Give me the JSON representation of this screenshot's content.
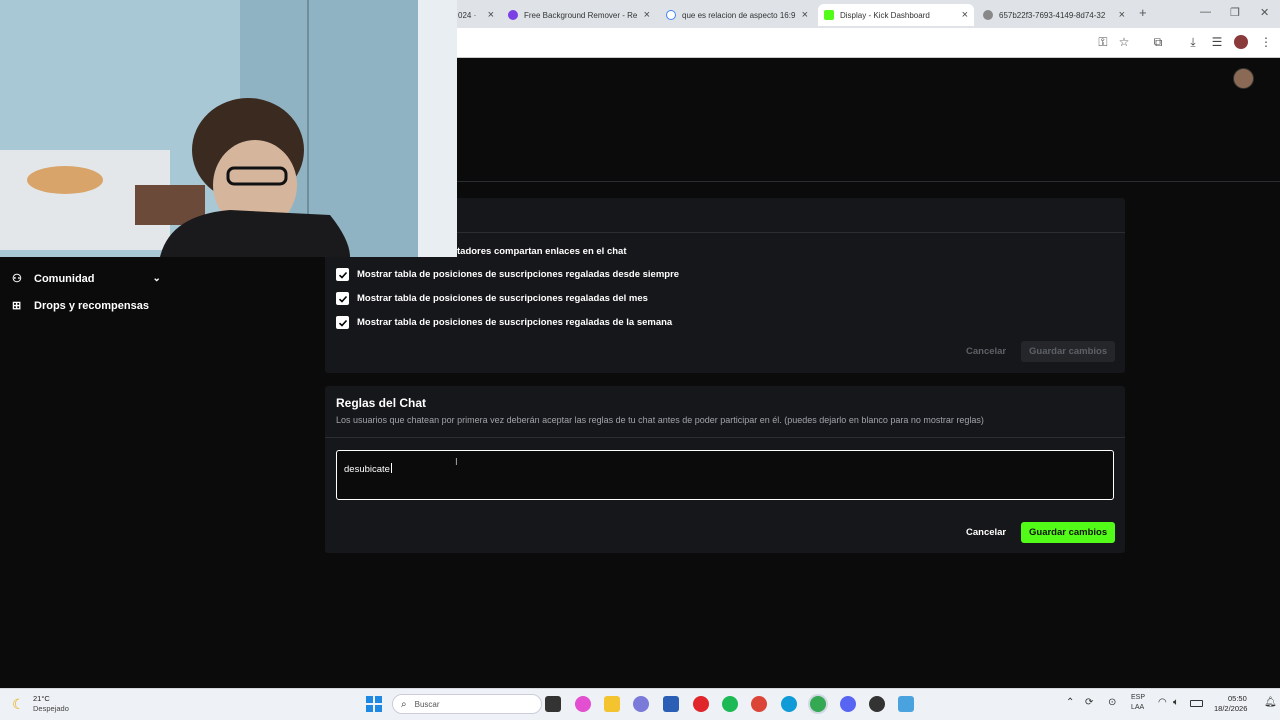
{
  "browser": {
    "tabs": [
      {
        "label": "024 ·"
      },
      {
        "label": "Free Background Remover - Re"
      },
      {
        "label": "que es relacion de aspecto 16:9"
      },
      {
        "label": "Display - Kick Dashboard"
      },
      {
        "label": "657b22f3-7693-4149-8d74-32"
      }
    ],
    "new_tab": "+"
  },
  "sidebar": {
    "items": [
      {
        "label": "Comunidad",
        "icon": "community-icon"
      },
      {
        "label": "Drops y recompensas",
        "icon": "gift-icon"
      }
    ]
  },
  "chat_settings": {
    "partial_option": "tadores compartan enlaces en el chat",
    "options": [
      {
        "label": "Mostrar tabla de posiciones de suscripciones regaladas desde siempre",
        "checked": true
      },
      {
        "label": "Mostrar tabla de posiciones de suscripciones regaladas del mes",
        "checked": true
      },
      {
        "label": "Mostrar tabla de posiciones de suscripciones regaladas de la semana",
        "checked": true
      }
    ],
    "cancel": "Cancelar",
    "save": "Guardar cambios"
  },
  "chat_rules": {
    "title": "Reglas del Chat",
    "description": "Los usuarios que chatean por primera vez deberán aceptar las reglas de tu chat antes de poder participar en él. (puedes dejarlo en blanco para no mostrar reglas)",
    "value": "desubicate",
    "cancel": "Cancelar",
    "save": "Guardar cambios"
  },
  "taskbar": {
    "weather_temp": "21°C",
    "weather_desc": "Despejado",
    "search": "Buscar",
    "lang": "ESP",
    "lang2": "LAA",
    "time": "05:50",
    "date": "18/2/2026"
  },
  "colors": {
    "accent": "#53fc18",
    "card": "#16171a",
    "bg": "#0b0b0c"
  }
}
